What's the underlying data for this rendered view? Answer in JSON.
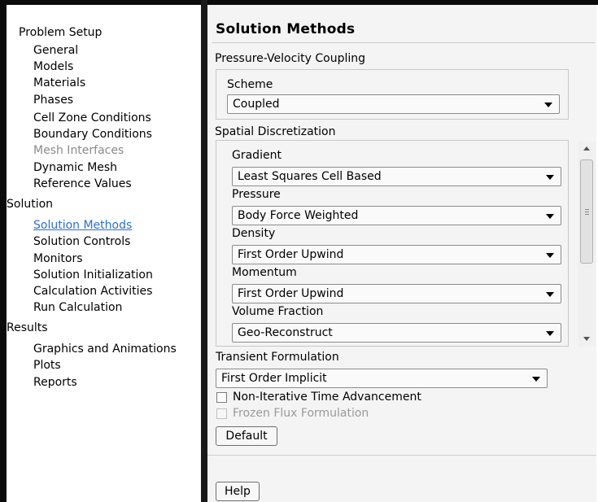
{
  "tree": {
    "problem_setup": "Problem Setup",
    "problem_setup_items": [
      "General",
      "Models",
      "Materials",
      "Phases",
      "Cell Zone Conditions",
      "Boundary Conditions",
      "Mesh Interfaces",
      "Dynamic Mesh",
      "Reference Values"
    ],
    "solution": "Solution",
    "solution_items": [
      "Solution Methods",
      "Solution Controls",
      "Monitors",
      "Solution Initialization",
      "Calculation Activities",
      "Run Calculation"
    ],
    "results": "Results",
    "results_items": [
      "Graphics and Animations",
      "Plots",
      "Reports"
    ],
    "selected_item": "Solution Methods",
    "disabled_item": "Mesh Interfaces"
  },
  "page": {
    "title": "Solution Methods",
    "pvc_label": "Pressure-Velocity Coupling",
    "scheme_label": "Scheme",
    "scheme_value": "Coupled",
    "spatial_label": "Spatial Discretization",
    "gradient_label": "Gradient",
    "gradient_value": "Least Squares Cell Based",
    "pressure_label": "Pressure",
    "pressure_value": "Body Force Weighted",
    "density_label": "Density",
    "density_value": "First Order Upwind",
    "momentum_label": "Momentum",
    "momentum_value": "First Order Upwind",
    "vf_label": "Volume Fraction",
    "vf_value": "Geo-Reconstruct",
    "transient_label": "Transient Formulation",
    "transient_value": "First Order Implicit",
    "nita_label": "Non-Iterative Time Advancement",
    "frozen_label": "Frozen Flux Formulation",
    "default_button": "Default",
    "help_button": "Help"
  }
}
